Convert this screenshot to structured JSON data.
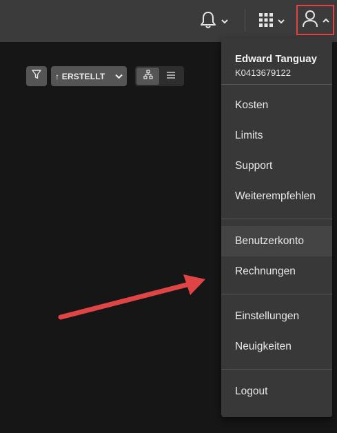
{
  "toolbar": {
    "sort_label": "↑ ERSTELLT"
  },
  "menu": {
    "user": {
      "name": "Edward Tanguay",
      "id": "K0413679122"
    },
    "group1": [
      "Kosten",
      "Limits",
      "Support",
      "Weiterempfehlen"
    ],
    "group2": [
      "Benutzerkonto",
      "Rechnungen"
    ],
    "group3": [
      "Einstellungen",
      "Neuigkeiten"
    ],
    "logout": "Logout"
  },
  "colors": {
    "topbar": "#3b3b3b",
    "background": "#161616",
    "menu": "#383838",
    "highlight_border": "#e04545",
    "annotation_arrow": "#e04545"
  },
  "icons": {
    "notifications": "bell-icon",
    "apps": "grid-icon",
    "user": "user-icon"
  }
}
